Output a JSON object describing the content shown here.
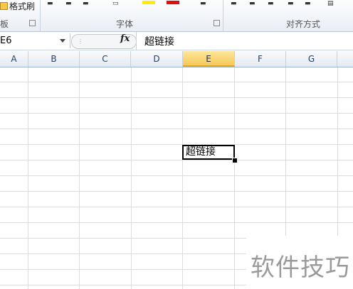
{
  "ribbon": {
    "format_painter_label": "格式刷",
    "clipboard_group_fragment": "板",
    "font_group_label": "字体",
    "alignment_group_label": "对齐方式",
    "colors": {
      "highlight": "#FFEC00",
      "font_color": "#E01010"
    }
  },
  "formula_bar": {
    "name_box": "E6",
    "fx_label": "fx",
    "content": "超链接"
  },
  "columns": [
    "A",
    "B",
    "C",
    "D",
    "E",
    "F",
    "G"
  ],
  "selected_column": "E",
  "active_cell": {
    "ref": "E6",
    "value": "超链接"
  },
  "watermark": "软件技巧"
}
